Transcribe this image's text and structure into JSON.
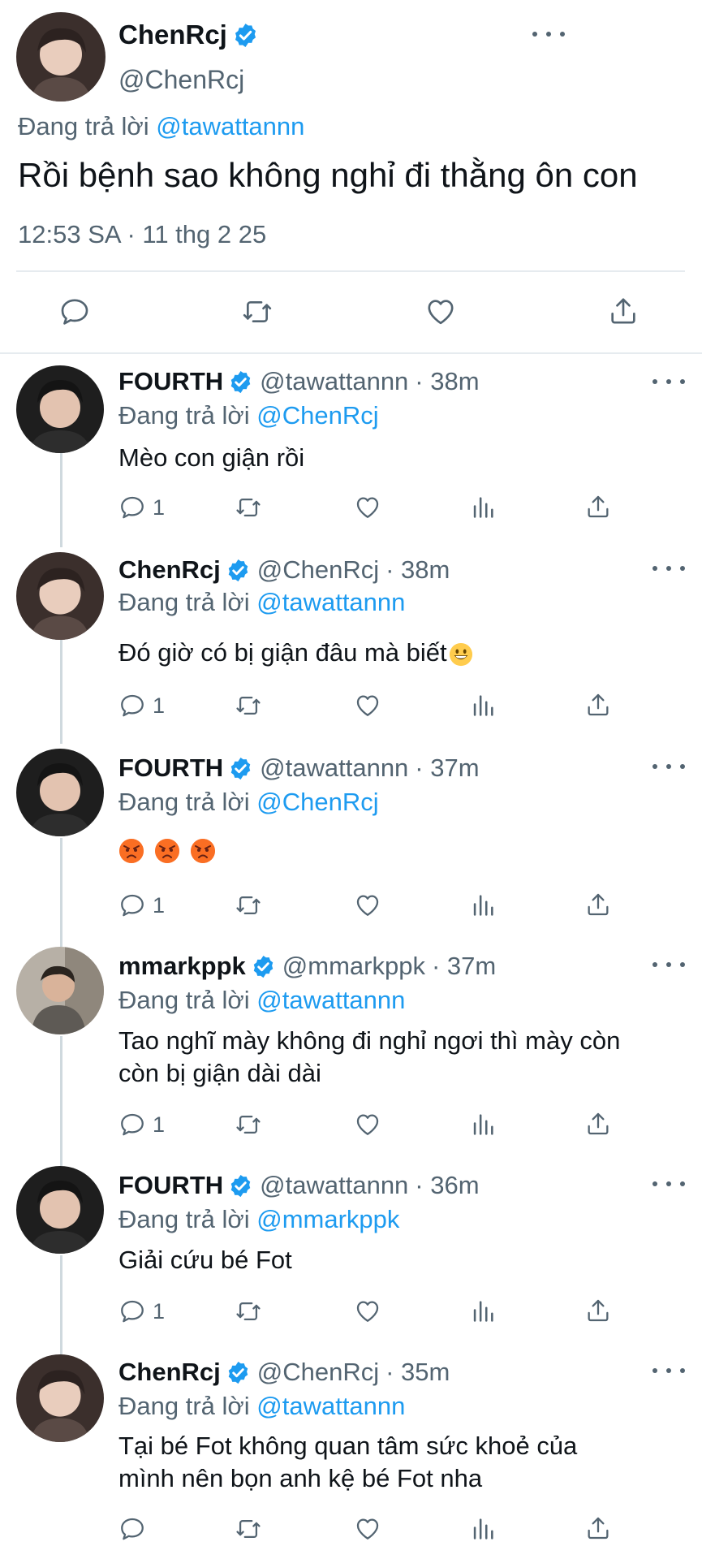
{
  "main_tweet": {
    "name": "ChenRcj",
    "handle": "@ChenRcj",
    "replying_prefix": "Đang trả lời",
    "replying_to": "@tawattannn",
    "text": "Rồi bệnh sao không nghỉ đi thằng ôn con",
    "timestamp": "12:53 SA · 11 thg 2 25"
  },
  "replies": [
    {
      "name": "FOURTH",
      "handle": "@tawattannn",
      "time": "· 38m",
      "replying_prefix": "Đang trả lời",
      "replying_to": "@ChenRcj",
      "text": "Mèo con giận rồi",
      "reply_count": "1"
    },
    {
      "name": "ChenRcj",
      "handle": "@ChenRcj",
      "time": "· 38m",
      "replying_prefix": "Đang trả lời",
      "replying_to": "@tawattannn",
      "text": "Đó giờ có bị giận đâu mà biết",
      "reply_count": "1"
    },
    {
      "name": "FOURTH",
      "handle": "@tawattannn",
      "time": "· 37m",
      "replying_prefix": "Đang trả lời",
      "replying_to": "@ChenRcj",
      "text": "",
      "reply_count": "1"
    },
    {
      "name": "mmarkppk",
      "handle": "@mmarkppk",
      "time": "· 37m",
      "replying_prefix": "Đang trả lời",
      "replying_to": "@tawattannn",
      "text_line1": "Tao nghĩ mày không đi nghỉ ngơi thì mày còn",
      "text_line2": "còn bị giận dài dài",
      "reply_count": "1"
    },
    {
      "name": "FOURTH",
      "handle": "@tawattannn",
      "time": "· 36m",
      "replying_prefix": "Đang trả lời",
      "replying_to": "@mmarkppk",
      "text": "Giải cứu bé Fot",
      "reply_count": "1"
    },
    {
      "name": "ChenRcj",
      "handle": "@ChenRcj",
      "time": "· 35m",
      "replying_prefix": "Đang trả lời",
      "replying_to": "@tawattannn",
      "text_line1": "Tại bé Fot không quan tâm sức khoẻ của",
      "text_line2": "mình nên bọn anh kệ bé Fot nha",
      "reply_count": ""
    }
  ],
  "icons": {
    "reply": "reply-icon",
    "retweet": "retweet-icon",
    "like": "heart-icon",
    "views": "views-icon",
    "share": "share-icon",
    "more": "more-icon",
    "verified": "verified-badge-icon",
    "grin": "grinning-emoji-icon",
    "angry": "angry-face-emoji-icon"
  },
  "colors": {
    "accent": "#1d9bf0",
    "text": "#0f1419",
    "secondary": "#536471",
    "verified": "#1d9bf0"
  }
}
